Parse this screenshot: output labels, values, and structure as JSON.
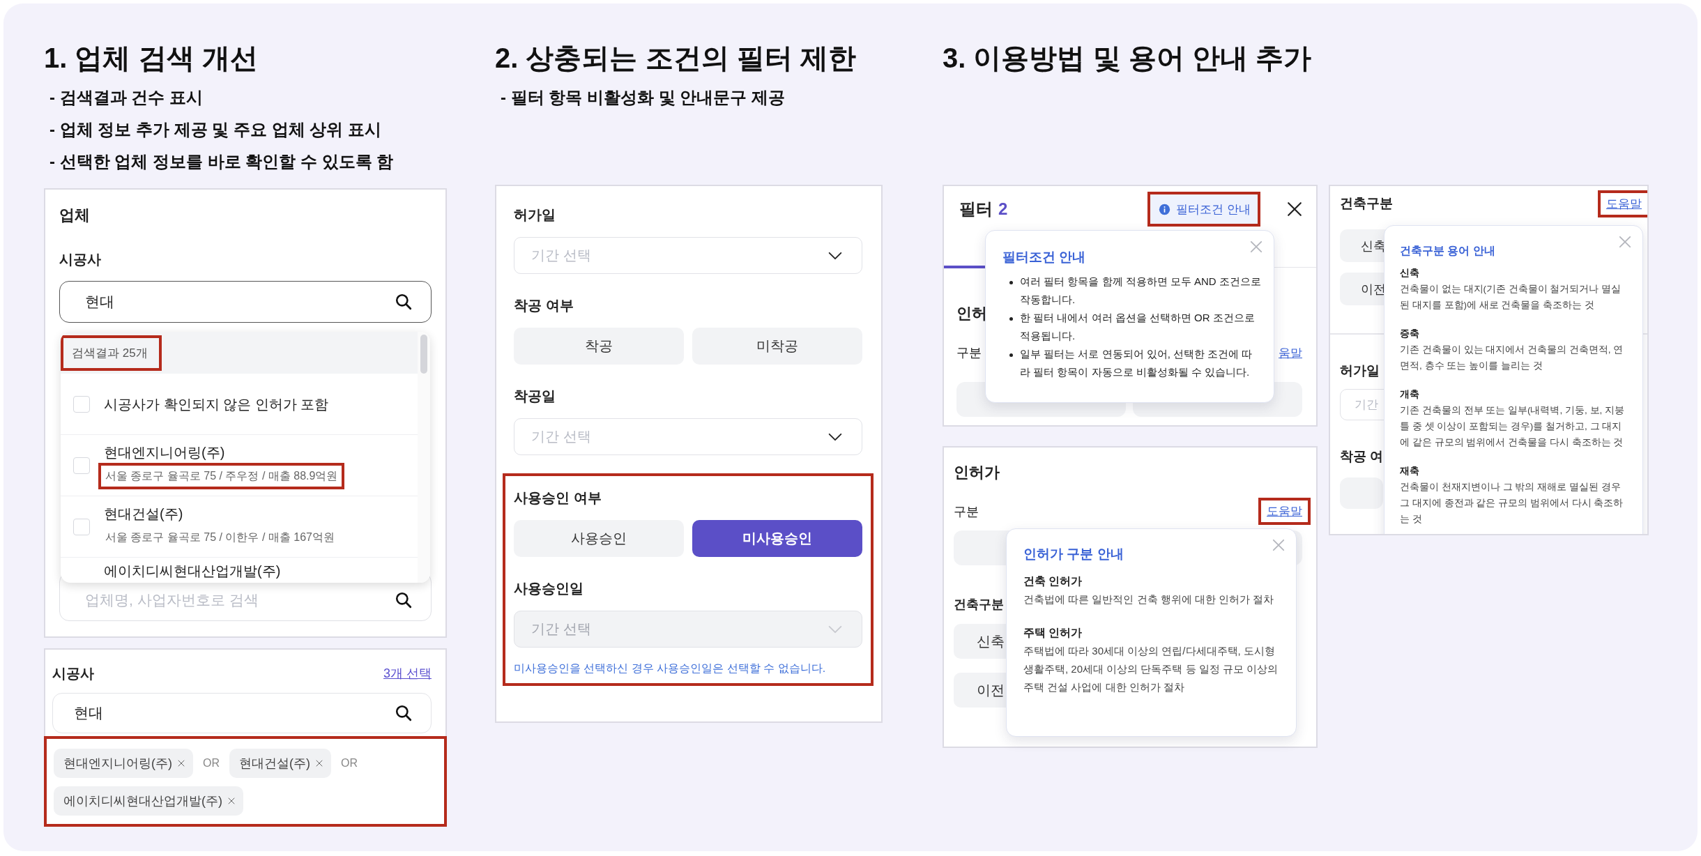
{
  "sections": [
    {
      "title": "1. 업체 검색 개선",
      "notes": [
        "- 검색결과 건수 표시",
        "- 업체 정보 추가 제공 및 주요 업체 상위 표시",
        "- 선택한 업체 정보를 바로 확인할 수 있도록 함"
      ]
    },
    {
      "title": "2. 상충되는 조건의 필터 제한",
      "notes": [
        "- 필터 항목 비활성화 및 안내문구 제공"
      ]
    },
    {
      "title": "3. 이용방법 및 용어 안내 추가"
    }
  ],
  "company_panel": {
    "heading": "업체",
    "label": "시공사",
    "search_value": "현대",
    "count": {
      "text": "검색결과 25개",
      "highlighted": true
    },
    "options": [
      {
        "name": "시공사가 확인되지 않은 인허가 포함",
        "checked": false
      },
      {
        "name": "현대엔지니어링(주)",
        "detail": "서울 종로구 율곡로 75 / 주우정 / 매출 88.9억원",
        "detail_highlighted": true,
        "checked": false
      },
      {
        "name": "현대건설(주)",
        "detail": "서울 종로구 율곡로 75 / 이한우 / 매출 167억원",
        "detail_highlighted": false,
        "checked": false
      },
      {
        "name": "에이치디씨현대산업개발(주)"
      }
    ],
    "placeholder": "업체명, 사업자번호로 검색"
  },
  "contractor_panel": {
    "label": "시공사",
    "selection_link": "3개 선택",
    "search_value": "현대",
    "chips_highlighted": true,
    "chips": [
      {
        "kind": "chip",
        "label": "현대엔지니어링(주)"
      },
      {
        "kind": "operator",
        "label": "OR"
      },
      {
        "kind": "chip",
        "label": "현대건설(주)"
      },
      {
        "kind": "operator",
        "label": "OR"
      },
      {
        "kind": "chip",
        "label": "에이치디씨현대산업개발(주)"
      }
    ]
  },
  "date_filters": {
    "groups": [
      {
        "highlighted": false,
        "fields": [
          {
            "kind": "select",
            "label": "허가일",
            "placeholder": "기간 선택",
            "disabled": false
          },
          {
            "kind": "toggle",
            "label": "착공 여부",
            "options": [
              {
                "label": "착공",
                "selected": false
              },
              {
                "label": "미착공",
                "selected": false
              }
            ]
          },
          {
            "kind": "select",
            "label": "착공일",
            "placeholder": "기간 선택",
            "disabled": false
          }
        ]
      },
      {
        "highlighted": true,
        "fields": [
          {
            "kind": "toggle",
            "label": "사용승인 여부",
            "options": [
              {
                "label": "사용승인",
                "selected": false
              },
              {
                "label": "미사용승인",
                "selected": true
              }
            ]
          },
          {
            "kind": "select",
            "label": "사용승인일",
            "placeholder": "기간 선택",
            "disabled": true
          },
          {
            "kind": "notice",
            "text": "미사용승인을 선택하신 경우 사용승인일은 선택할 수 없습니다."
          }
        ]
      }
    ]
  },
  "filter_panel": {
    "title": "필터",
    "count": "2",
    "guide_button": {
      "label": "필터조건 안내",
      "highlighted": true
    },
    "covered_heading": "인허",
    "covered_label": "구분",
    "covered_link": "움말",
    "popover": {
      "title": "필터조건 안내",
      "bullets": [
        "여러 필터 항목을 함께 적용하면 모두 AND 조건으로 작동합니다.",
        "한 필터 내에서 여러 옵션을 선택하면 OR 조건으로 적용됩니다.",
        "일부 필터는 서로 연동되어 있어, 선택한 조건에 따라 필터 항목이 자동으로 비활성화될 수 있습니다."
      ]
    }
  },
  "permit_panel": {
    "heading": "인허가",
    "label": "구분",
    "help_link": {
      "label": "도움말",
      "highlighted": true
    },
    "type_label": "건축구분",
    "type_options": [
      "신축",
      "이전"
    ],
    "popover": {
      "title": "인허가 구분 안내",
      "terms": [
        {
          "term": "건축 인허가",
          "desc": "건축법에 따른 일반적인 건축 행위에 대한 인허가 절차"
        },
        {
          "term": "주택 인허가",
          "desc": "주택법에 따라 30세대 이상의 연립/다세대주택, 도시형생활주택, 20세대 이상의 단독주택 등 일정 규모 이상의 주택 건설 사업에 대한 인허가 절차"
        }
      ]
    }
  },
  "building_type_panel": {
    "heading": "건축구분",
    "help_link": {
      "label": "도움말",
      "highlighted": true
    },
    "options": [
      "신축",
      "이전"
    ],
    "date_label": "허가일",
    "date_placeholder": "기간",
    "start_label": "착공 여",
    "popover": {
      "title": "건축구분 용어 안내",
      "terms": [
        {
          "term": "신축",
          "desc": "건축물이 없는 대지(기존 건축물이 철거되거나 멸실된 대지를 포함)에 새로 건축물을 축조하는 것"
        },
        {
          "term": "증축",
          "desc": "기존 건축물이 있는 대지에서 건축물의 건축면적, 연면적, 층수 또는 높이를 늘리는 것"
        },
        {
          "term": "개축",
          "desc": "기존 건축물의 전부 또는 일부(내력벽, 기둥, 보, 지붕틀 중 셋 이상이 포함되는 경우)를 철거하고, 그 대지에 같은 규모의 범위에서 건축물을 다시 축조하는 것"
        },
        {
          "term": "재축",
          "desc": "건축물이 천재지변이나 그 밖의 재해로 멸실된 경우그 대지에 종전과 같은 규모의 범위에서 다시 축조하는 것"
        }
      ]
    }
  }
}
